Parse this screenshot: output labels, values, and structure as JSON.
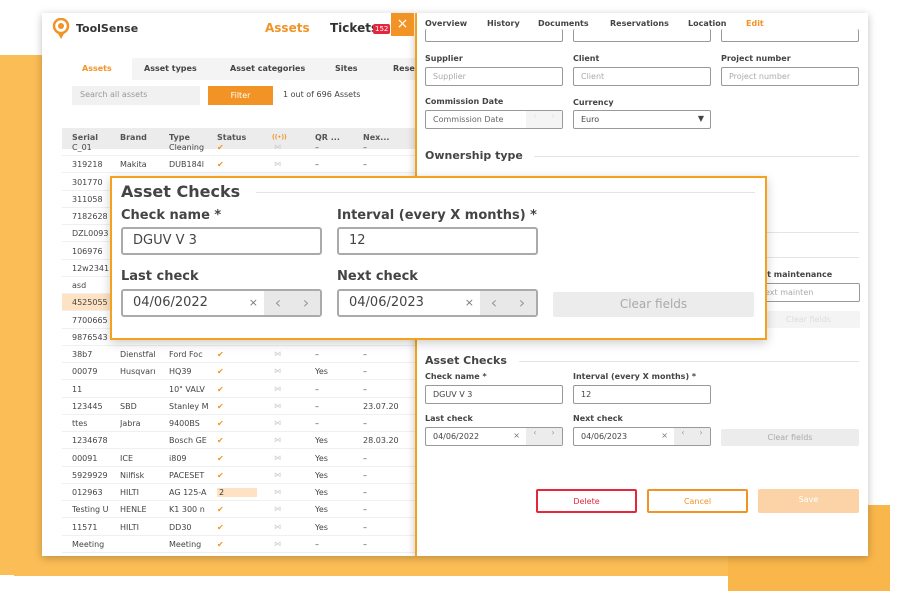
{
  "app": {
    "brand": "ToolSense",
    "nav_assets": "Assets",
    "nav_tickets": "Tickets",
    "tickets_badge": "152",
    "close_icon": "×"
  },
  "left": {
    "subtabs": [
      "Assets",
      "Asset types",
      "Asset categories",
      "Sites",
      "Rese"
    ],
    "search_placeholder": "Search all assets",
    "filter_label": "Filter",
    "count": "1 out of 696 Assets",
    "columns": [
      "Serial",
      "Brand",
      "Type",
      "Status",
      "((•))",
      "QR ...",
      "Nex...",
      ""
    ],
    "rows": [
      [
        "C_01",
        "",
        "Cleaning",
        "✔",
        "–",
        "–"
      ],
      [
        "319218",
        "Makita",
        "DUB184l",
        "✔",
        "–",
        "–"
      ],
      [
        "301770",
        "",
        "",
        "",
        "",
        ""
      ],
      [
        "311058",
        "",
        "",
        "",
        "",
        ""
      ],
      [
        "7182628",
        "",
        "",
        "",
        "",
        ""
      ],
      [
        "DZL0093",
        "",
        "",
        "",
        "",
        ""
      ],
      [
        "106976",
        "",
        "",
        "",
        "",
        ""
      ],
      [
        "12w2341",
        "",
        "",
        "",
        "",
        ""
      ],
      [
        "asd",
        "",
        "",
        "",
        "",
        ""
      ],
      [
        "4525055",
        "",
        "",
        "",
        "",
        ""
      ],
      [
        "7700665",
        "",
        "",
        "",
        "",
        ""
      ],
      [
        "9876543",
        "",
        "",
        "",
        "",
        ""
      ],
      [
        "38b7",
        "Dienstfal",
        "Ford Foc",
        "✔",
        "–",
        "–"
      ],
      [
        "00079",
        "Husqvarı",
        "HQ39",
        "✔",
        "Yes",
        "–"
      ],
      [
        "11",
        "",
        "10\" VALV",
        "✔",
        "–",
        "–"
      ],
      [
        "123445",
        "SBD",
        "Stanley M",
        "✔",
        "–",
        "23.07.20"
      ],
      [
        "ttes",
        "Jabra",
        "9400BS",
        "✔",
        "–",
        "–"
      ],
      [
        "1234678",
        "",
        "Bosch GE",
        "✔",
        "Yes",
        "28.03.20"
      ],
      [
        "00091",
        "ICE",
        "i809",
        "✔",
        "Yes",
        "–"
      ],
      [
        "5929929",
        "Nilfisk",
        "PACESET",
        "✔",
        "Yes",
        "–"
      ],
      [
        "012963",
        "HILTI",
        "AG 125-A",
        "2",
        "Yes",
        "–"
      ],
      [
        "Testing U",
        "HENLE",
        "K1 300 n",
        "✔",
        "Yes",
        "–"
      ],
      [
        "11571",
        "HILTI",
        "DD30",
        "✔",
        "Yes",
        "–"
      ],
      [
        "Meeting",
        "",
        "Meeting",
        "✔",
        "–",
        "–"
      ]
    ]
  },
  "right": {
    "tabs": [
      "Overview",
      "History",
      "Documents",
      "Reservations",
      "Location",
      "Edit"
    ],
    "supplier": {
      "label": "Supplier",
      "placeholder": "Supplier"
    },
    "client": {
      "label": "Client",
      "placeholder": "Client"
    },
    "project": {
      "label": "Project number",
      "placeholder": "Project number"
    },
    "commission": {
      "label": "Commission Date",
      "placeholder": "Commission Date"
    },
    "currency": {
      "label": "Currency",
      "value": "Euro"
    },
    "ownership_title": "Ownership type",
    "next_maintenance": {
      "label": "xt maintenance",
      "placeholder": "ext mainten"
    },
    "clear_small": "Clear fields",
    "checks": {
      "title": "Asset Checks",
      "check_name_label": "Check name *",
      "check_name": "DGUV V 3",
      "interval_label": "Interval (every X months) *",
      "interval": "12",
      "last_label": "Last check",
      "last": "04/06/2022",
      "next_label": "Next check",
      "next": "04/06/2023",
      "clear": "Clear fields"
    },
    "delete": "Delete",
    "cancel": "Cancel",
    "save": "Save"
  },
  "popup": {
    "title": "Asset Checks",
    "check_name_label": "Check name *",
    "check_name": "DGUV V 3",
    "interval_label": "Interval (every X months) *",
    "interval": "12",
    "last_label": "Last check",
    "last": "04/06/2022",
    "next_label": "Next check",
    "next": "04/06/2023",
    "clear": "Clear fields"
  },
  "colors": {
    "accent": "#f29326",
    "danger": "#e5273d",
    "highlight": "#fde3c4"
  }
}
